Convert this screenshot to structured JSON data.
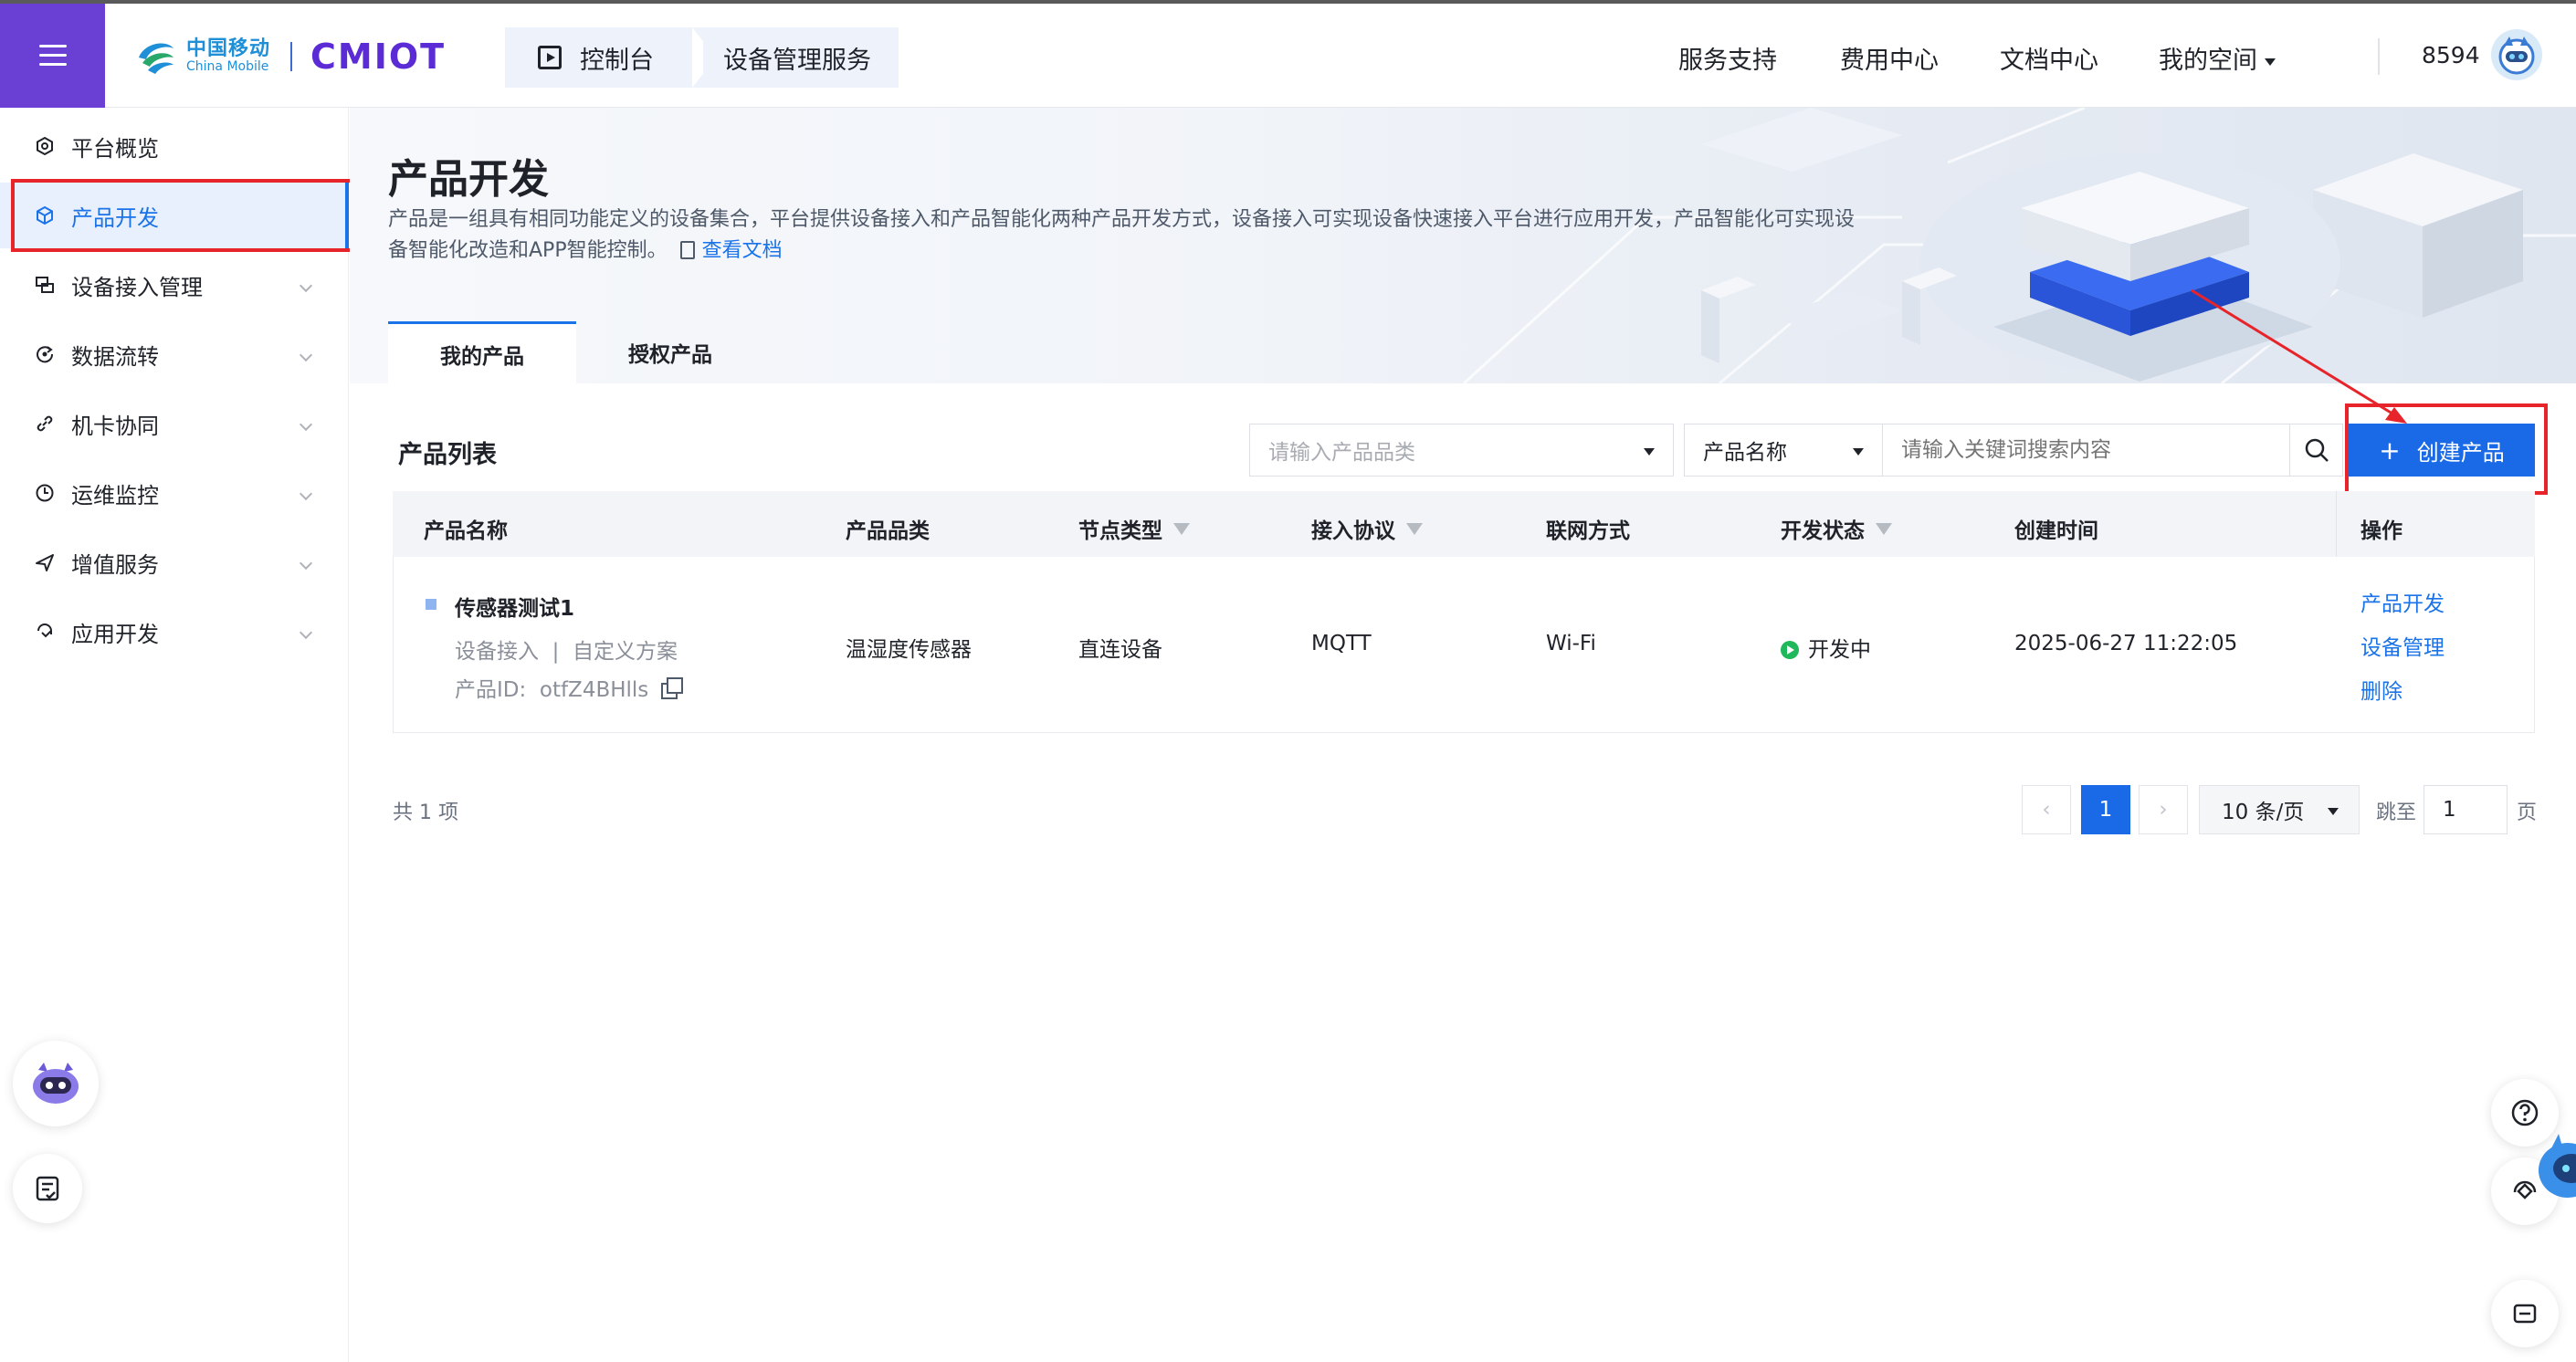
{
  "header": {
    "logo_cn": "中国移动",
    "logo_en": "China Mobile",
    "brand": "CMIOT",
    "breadcrumb": [
      "控制台",
      "设备管理服务"
    ],
    "nav": [
      "服务支持",
      "费用中心",
      "文档中心",
      "我的空间"
    ],
    "user_id": "8594"
  },
  "sidebar": {
    "items": [
      {
        "label": "平台概览",
        "icon": "overview-icon",
        "expandable": false
      },
      {
        "label": "产品开发",
        "icon": "cube-icon",
        "expandable": false,
        "active": true
      },
      {
        "label": "设备接入管理",
        "icon": "device-access-icon",
        "expandable": true
      },
      {
        "label": "数据流转",
        "icon": "data-flow-icon",
        "expandable": true
      },
      {
        "label": "机卡协同",
        "icon": "card-link-icon",
        "expandable": true
      },
      {
        "label": "运维监控",
        "icon": "monitor-icon",
        "expandable": true
      },
      {
        "label": "增值服务",
        "icon": "value-added-icon",
        "expandable": true
      },
      {
        "label": "应用开发",
        "icon": "app-dev-icon",
        "expandable": true
      }
    ]
  },
  "page": {
    "title": "产品开发",
    "description_line1": "产品是一组具有相同功能定义的设备集合，平台提供设备接入和产品智能化两种产品开发方式，设备接入可实现设备快速接入平台进行应用开发，产品智能化可实现设",
    "description_line2": "备智能化改造和APP智能控制。",
    "doc_link": "查看文档",
    "tabs": [
      "我的产品",
      "授权产品"
    ]
  },
  "list": {
    "title": "产品列表",
    "category_placeholder": "请输入产品品类",
    "field_select": "产品名称",
    "keyword_placeholder": "请输入关键词搜索内容",
    "create_label": "创建产品",
    "columns": [
      "产品名称",
      "产品品类",
      "节点类型",
      "接入协议",
      "联网方式",
      "开发状态",
      "创建时间",
      "操作"
    ],
    "rows": [
      {
        "name": "传感器测试1",
        "meta_access": "设备接入",
        "meta_sep": "|",
        "meta_scheme": "自定义方案",
        "id_label": "产品ID:",
        "id_value": "otfZ4BHlls",
        "category": "温湿度传感器",
        "node_type": "直连设备",
        "protocol": "MQTT",
        "network": "Wi-Fi",
        "status": "开发中",
        "created": "2025-06-27 11:22:05",
        "actions": [
          "产品开发",
          "设备管理",
          "删除"
        ]
      }
    ]
  },
  "pagination": {
    "total": "共 1 项",
    "current_page": "1",
    "page_size": "10 条/页",
    "jump_label": "跳至",
    "jump_value": "1",
    "page_label": "页"
  },
  "colors": {
    "accent": "#1a6ae8",
    "menu_bg": "#6a3fd4",
    "highlight": "#e8242b",
    "status_green": "#20b85a"
  }
}
